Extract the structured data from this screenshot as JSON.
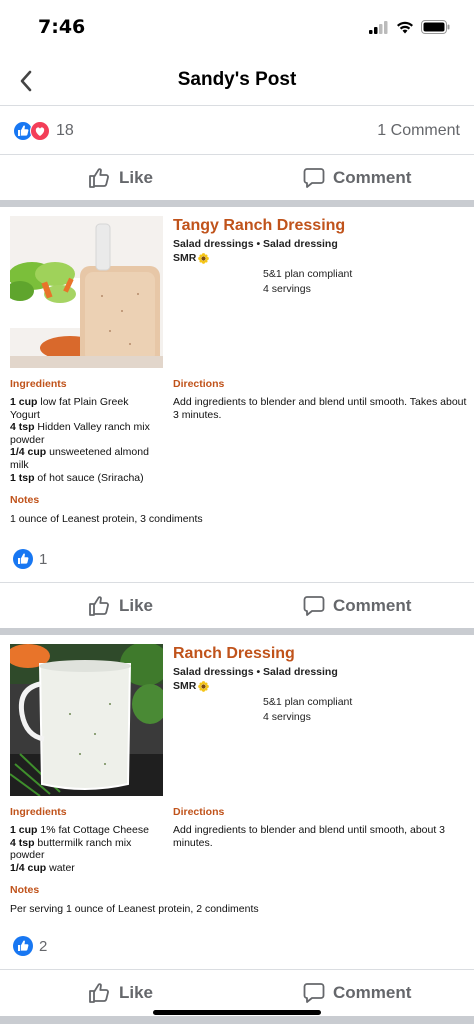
{
  "status": {
    "time": "7:46"
  },
  "nav": {
    "title": "Sandy's Post"
  },
  "post": {
    "reaction_count": "18",
    "comment_count": "1 Comment"
  },
  "actions": {
    "like": "Like",
    "comment": "Comment"
  },
  "recipes": [
    {
      "title": "Tangy Ranch Dressing",
      "category": "Salad dressings • Salad dressing",
      "tag": "SMR",
      "plan": "5&1 plan compliant",
      "servings": "4 servings",
      "ingredients_label": "Ingredients",
      "ingredients": [
        {
          "qty": "1 cup",
          "text": " low fat Plain Greek Yogurt"
        },
        {
          "qty": "4 tsp",
          "text": " Hidden Valley ranch mix powder"
        },
        {
          "qty": "1/4 cup",
          "text": " unsweetened almond milk"
        },
        {
          "qty": "1 tsp",
          "text": " of hot sauce (Sriracha)"
        }
      ],
      "directions_label": "Directions",
      "directions": "Add ingredients to blender and blend until smooth. Takes about 3 minutes.",
      "notes_label": "Notes",
      "notes": "1 ounce of Leanest protein, 3 condiments",
      "like_count": "1"
    },
    {
      "title": "Ranch Dressing",
      "category": "Salad dressings • Salad dressing",
      "tag": "SMR",
      "plan": "5&1 plan compliant",
      "servings": "4 servings",
      "ingredients_label": "Ingredients",
      "ingredients": [
        {
          "qty": "1 cup",
          "text": " 1% fat Cottage Cheese"
        },
        {
          "qty": "4 tsp",
          "text": " buttermilk ranch mix powder"
        },
        {
          "qty": "1/4 cup",
          "text": " water"
        }
      ],
      "directions_label": "Directions",
      "directions": "Add ingredients to blender and blend until smooth, about 3 minutes.",
      "notes_label": "Notes",
      "notes": "Per serving 1 ounce of Leanest protein, 2 condiments",
      "like_count": "2"
    }
  ],
  "icons": {
    "back": "chevron-left-icon",
    "like_reaction": "like-reaction-icon",
    "love_reaction": "love-reaction-icon",
    "thumbs_up": "thumbs-up-icon",
    "comment": "comment-bubble-icon",
    "sunflower": "sunflower-icon"
  },
  "colors": {
    "accent": "#c0531b",
    "facebook_blue": "#1877f2",
    "love_red": "#f33e58",
    "muted": "#65676b",
    "divider": "#c9ccd1"
  }
}
